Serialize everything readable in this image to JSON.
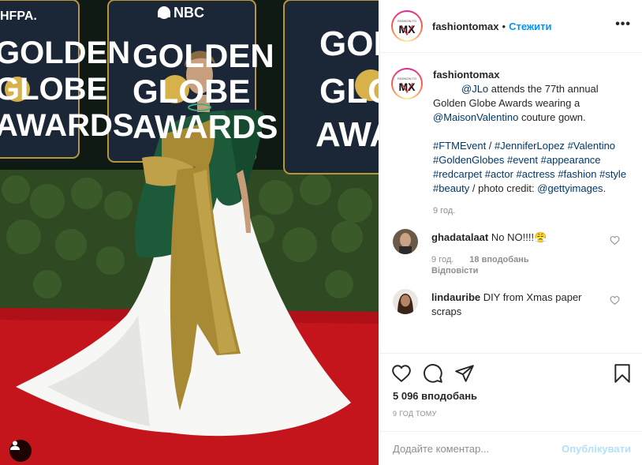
{
  "photo": {
    "sign_left_lines": [
      "GOLDEN",
      "GLOBE",
      "AWARDS"
    ],
    "sign_center_lines": [
      "GOLDEN",
      "GLOBE",
      "AWARDS"
    ],
    "sign_right_lines": [
      "GOLDEN",
      "GLOBE",
      "AWARDS"
    ],
    "hfpa_text": "HFPA.",
    "nbc_text": "NBC",
    "colors": {
      "carpet": "#c4141c",
      "gown_white": "#f7f7f5",
      "gown_green": "#1d5a3a",
      "gown_gold": "#a88a35",
      "hedge": "#2f4a22"
    }
  },
  "header": {
    "username": "fashiontomax",
    "separator": "•",
    "follow_label": "Стежити",
    "more_label": "•••"
  },
  "caption": {
    "username": "fashiontomax",
    "mention_1": "@JLo",
    "text_1": " attends the 77th annual Golden Globe Awards wearing a ",
    "mention_2": "@MaisonValentino",
    "text_2": " couture gown.",
    "hashtags": [
      "#FTMEvent",
      "#JenniferLopez",
      "#Valentino",
      "#GoldenGlobes",
      "#event",
      "#appearance",
      "#redcarpet",
      "#actor",
      "#actress",
      "#fashion",
      "#style",
      "#beauty"
    ],
    "text_3": "photo credit: ",
    "mention_3": "@gettyimages",
    "text_4": ".",
    "time": "9 год."
  },
  "comments": [
    {
      "username": "ghadatalaat",
      "text": "No NO!!!!😤",
      "time": "9 год.",
      "likes": "18 вподобань",
      "reply": "Відповісти"
    },
    {
      "username": "lindauribe",
      "text": "DIY from Xmas paper scraps"
    }
  ],
  "likes_total": "5 096 вподобань",
  "time_total": "9 ГОД ТОМУ",
  "add_comment": {
    "placeholder": "Додайте коментар...",
    "publish_label": "Опублікувати"
  },
  "icons": [
    "tag-user-icon",
    "heart-icon",
    "comment-icon",
    "share-icon",
    "bookmark-icon",
    "more-icon"
  ]
}
